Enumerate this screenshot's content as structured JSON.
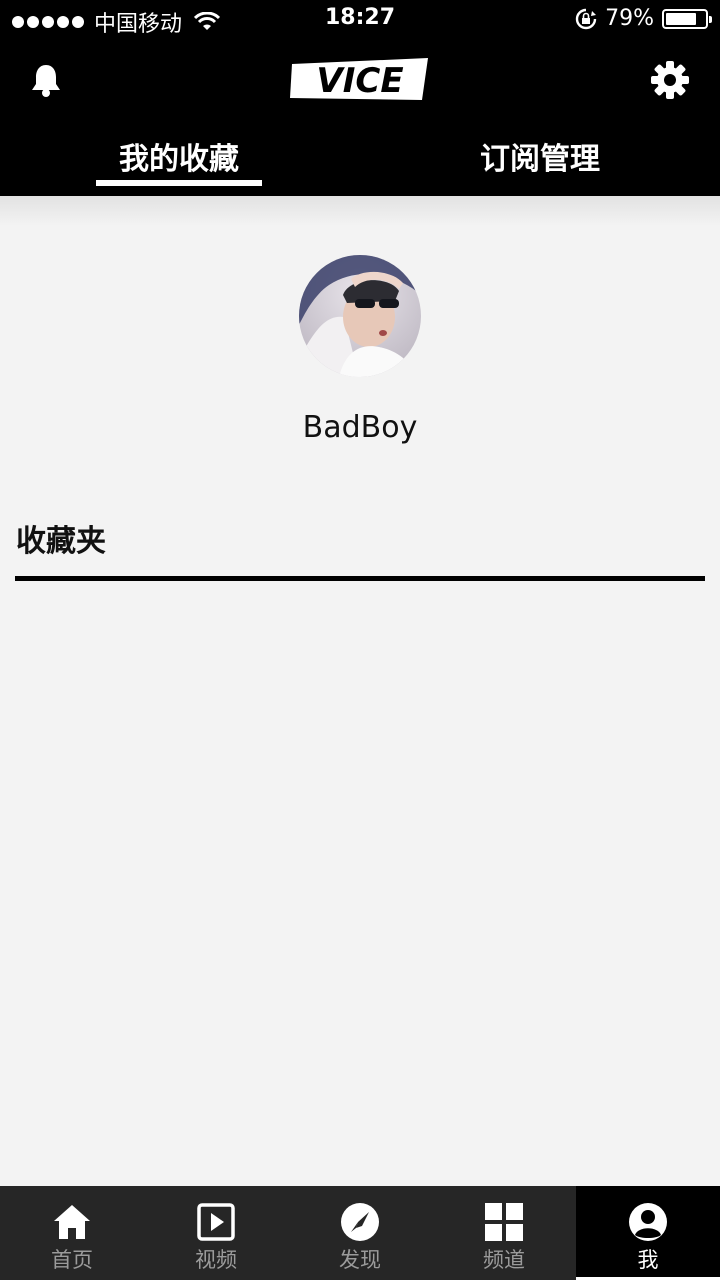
{
  "status_bar": {
    "carrier": "中国移动",
    "time": "18:27",
    "battery_percent": "79%",
    "battery_level": 0.79
  },
  "header": {
    "logo_text": "VICE",
    "tabs": [
      {
        "label": "我的收藏",
        "active": true
      },
      {
        "label": "订阅管理",
        "active": false
      }
    ],
    "icons": {
      "left": "bell-icon",
      "right": "gear-icon"
    }
  },
  "profile": {
    "username": "BadBoy"
  },
  "section": {
    "title": "收藏夹"
  },
  "bottom_nav": {
    "items": [
      {
        "label": "首页",
        "icon": "home-icon",
        "active": false
      },
      {
        "label": "视频",
        "icon": "video-play-icon",
        "active": false
      },
      {
        "label": "发现",
        "icon": "compass-icon",
        "active": false
      },
      {
        "label": "频道",
        "icon": "grid-icon",
        "active": false
      },
      {
        "label": "我",
        "icon": "user-icon",
        "active": true
      }
    ]
  },
  "colors": {
    "header_bg": "#000000",
    "page_bg": "#f3f3f3",
    "nav_bg": "#262626",
    "nav_inactive": "#9b9b9b",
    "nav_active": "#ffffff"
  }
}
